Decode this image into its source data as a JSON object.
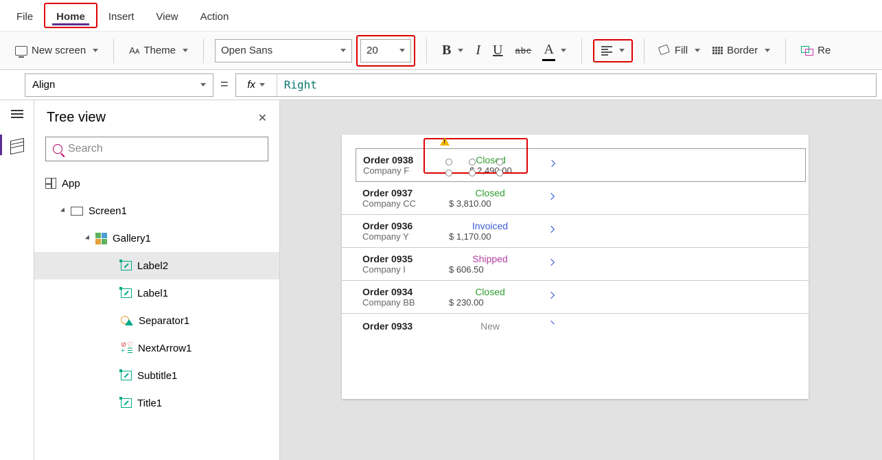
{
  "menu": {
    "file": "File",
    "home": "Home",
    "insert": "Insert",
    "view": "View",
    "action": "Action"
  },
  "ribbon": {
    "new_screen": "New screen",
    "theme": "Theme",
    "font": "Open Sans",
    "size": "20",
    "bold": "B",
    "italic": "I",
    "underline": "U",
    "strike": "abc",
    "fontcolor": "A",
    "fill": "Fill",
    "border": "Border",
    "reorder": "Re"
  },
  "formula": {
    "property": "Align",
    "value": "Right"
  },
  "tree": {
    "title": "Tree view",
    "search_placeholder": "Search",
    "nodes": {
      "app": "App",
      "screen": "Screen1",
      "gallery": "Gallery1",
      "label2": "Label2",
      "label1": "Label1",
      "separator": "Separator1",
      "nextarrow": "NextArrow1",
      "subtitle": "Subtitle1",
      "title_n": "Title1"
    }
  },
  "orders": [
    {
      "id": "Order 0938",
      "company": "Company F",
      "status": "Closed",
      "price": "$ 2,490.00"
    },
    {
      "id": "Order 0937",
      "company": "Company CC",
      "status": "Closed",
      "price": "$ 3,810.00"
    },
    {
      "id": "Order 0936",
      "company": "Company Y",
      "status": "Invoiced",
      "price": "$ 1,170.00"
    },
    {
      "id": "Order 0935",
      "company": "Company I",
      "status": "Shipped",
      "price": "$ 606.50"
    },
    {
      "id": "Order 0934",
      "company": "Company BB",
      "status": "Closed",
      "price": "$ 230.00"
    },
    {
      "id": "Order 0933",
      "company": "",
      "status": "New",
      "price": ""
    }
  ]
}
